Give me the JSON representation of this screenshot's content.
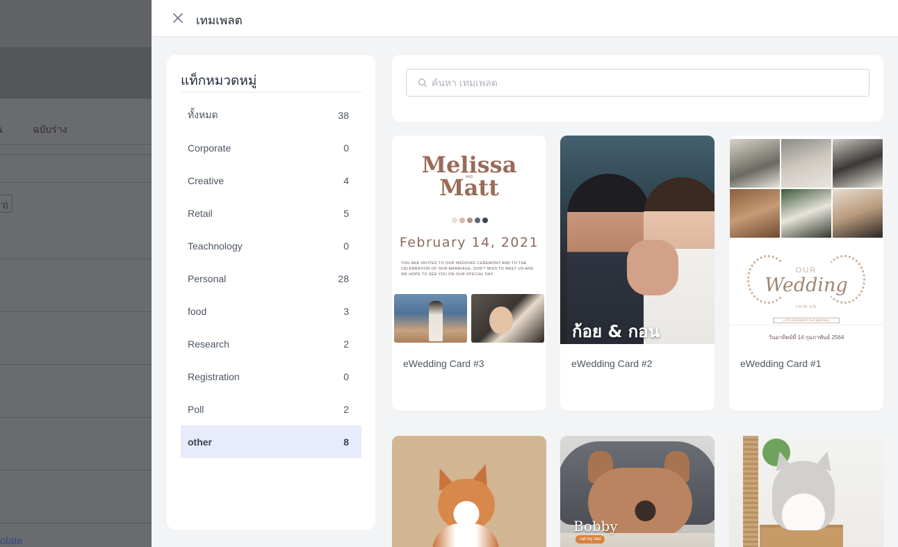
{
  "background_app": {
    "tabs": [
      "น",
      "ฉบับร่าง"
    ],
    "chip_text": "ว)",
    "bottom_link": "olate"
  },
  "drawer": {
    "title": "เทมเพลต",
    "close_icon": "close-icon"
  },
  "categories": {
    "heading": "แท็กหมวดหมู่",
    "items": [
      {
        "label": "ทั้งหมด",
        "count": "38"
      },
      {
        "label": "Corporate",
        "count": "0"
      },
      {
        "label": "Creative",
        "count": "4"
      },
      {
        "label": "Retail",
        "count": "5"
      },
      {
        "label": "Teachnology",
        "count": "0"
      },
      {
        "label": "Personal",
        "count": "28"
      },
      {
        "label": "food",
        "count": "3"
      },
      {
        "label": "Research",
        "count": "2"
      },
      {
        "label": "Registration",
        "count": "0"
      },
      {
        "label": "Poll",
        "count": "2"
      },
      {
        "label": "other",
        "count": "8"
      }
    ],
    "active": "other",
    "active_color": "#e8ebfb"
  },
  "search": {
    "placeholder": "ค้นหา เทมเพลต",
    "value": "",
    "icon": "search-icon"
  },
  "templates": [
    {
      "title": "eWedding Card #3",
      "thumb": {
        "names_line1": "Melissa",
        "and": "AND",
        "names_line2": "Matt",
        "date": "February 14, 2021",
        "invite": "You are invited to our wedding ceremony and to the celebration of our marriage. Don't miss to meet us and we hope to see you on our special day",
        "dot_colors": [
          "#eedfd2",
          "#d9b9a3",
          "#b69482",
          "#5c6472",
          "#3c4657"
        ]
      }
    },
    {
      "title": "eWedding Card #2",
      "thumb": {
        "caption": "ก้อย & กอน"
      }
    },
    {
      "title": "eWedding Card #1",
      "thumb": {
        "our": "OUR",
        "wedding": "Wedding",
        "join": "JOIN US",
        "celebrate": "LET'S CELEBRATE OUR WEDDING",
        "date_th": "วันอาทิตย์ที่ 14 กุมภาพันธ์ 2564"
      }
    },
    {
      "title": "",
      "thumb": {}
    },
    {
      "title": "",
      "thumb": {
        "name": "Bobby",
        "call": "call my dad"
      }
    },
    {
      "title": "",
      "thumb": {}
    }
  ]
}
